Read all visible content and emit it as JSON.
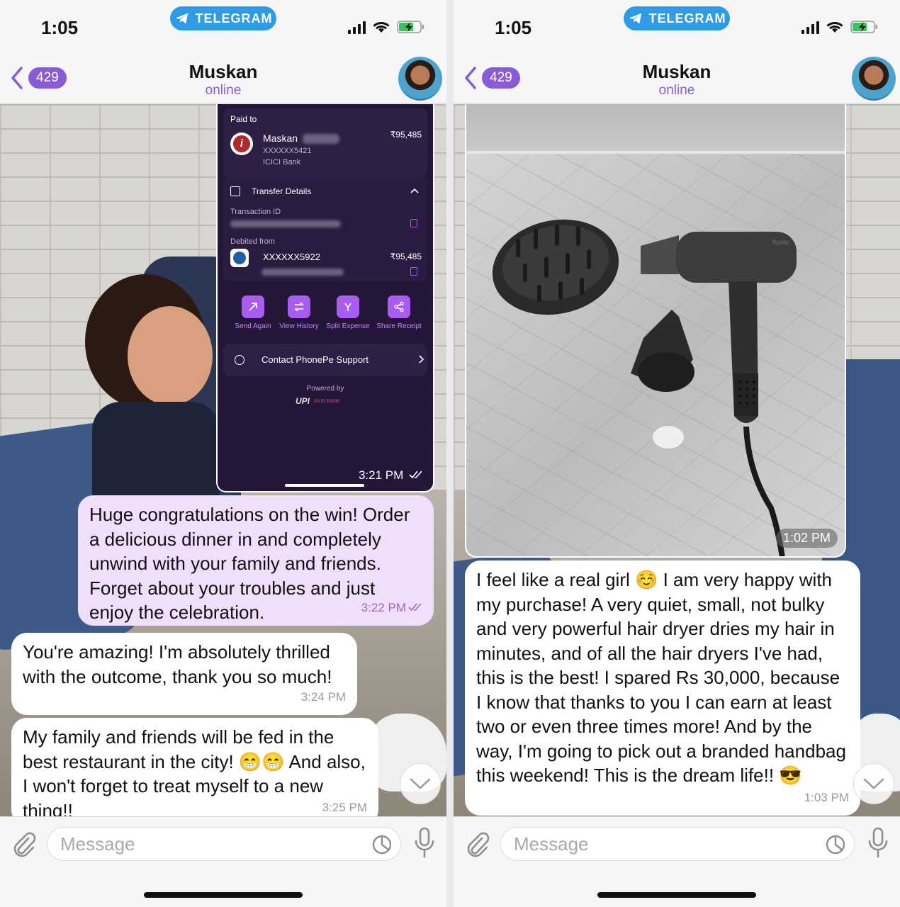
{
  "screens": [
    {
      "status": {
        "time": "1:05",
        "app_pill": "TELEGRAM"
      },
      "header": {
        "back_count": "429",
        "name": "Muskan",
        "status": "online"
      },
      "payment_card": {
        "paid_to_label": "Paid to",
        "payee_name": "Maskan",
        "payee_account": "XXXXXX5421",
        "payee_bank": "ICICI Bank",
        "amount": "₹95,485",
        "transfer_details_label": "Transfer Details",
        "transaction_id_label": "Transaction ID",
        "debited_from_label": "Debited from",
        "debit_account": "XXXXXX5922",
        "debit_amount": "₹95,485",
        "actions": [
          "Send Again",
          "View History",
          "Split Expense",
          "Share Receipt"
        ],
        "support_label": "Contact PhonePe Support",
        "powered_by": "Powered by",
        "upi_logo": "UPI",
        "bank_logo": "AXIS BANK",
        "time": "3:21 PM"
      },
      "messages": [
        {
          "type": "outgoing",
          "text": "Huge congratulations on the win! Order a delicious dinner in and completely unwind with your family and friends. Forget about your troubles and just enjoy the celebration.",
          "time": "3:22 PM"
        },
        {
          "type": "incoming",
          "text": "You're amazing! I'm absolutely thrilled with the outcome, thank you so much!",
          "time": "3:24 PM"
        },
        {
          "type": "incoming",
          "text": "My family and friends will be fed in the best restaurant in the city! 😁😁 And also, I won't forget to treat myself to a new thing!!",
          "time": "3:25 PM"
        }
      ],
      "input": {
        "placeholder": "Message"
      }
    },
    {
      "status": {
        "time": "1:05",
        "app_pill": "TELEGRAM"
      },
      "header": {
        "back_count": "429",
        "name": "Muskan",
        "status": "online"
      },
      "media": {
        "time": "1:02 PM",
        "brand_text": "Sprits"
      },
      "messages": [
        {
          "type": "incoming",
          "text": "I feel like a real girl ☺️ I am very happy with my purchase! A very quiet, small, not bulky and very powerful hair dryer dries my hair in minutes, and of all the hair dryers I've had, this is the best! I spared Rs 30,000, because I know that thanks to you I can earn at least two or even three times more! And by the way, I'm going to pick out a branded handbag this weekend! This is the dream life!! 😎",
          "time": "1:03 PM"
        }
      ],
      "input": {
        "placeholder": "Message"
      }
    }
  ],
  "colors": {
    "accent": "#8a5bd6",
    "telegram_blue": "#2e9be8",
    "outgoing_bubble": "#efdffb",
    "incoming_bubble": "#ffffff",
    "phonepe_bg": "#241638",
    "phonepe_action": "#a85cf0"
  },
  "icons": [
    "telegram-icon",
    "signal-icon",
    "wifi-icon",
    "battery-charging-icon",
    "back-chevron-icon",
    "attach-icon",
    "sticker-icon",
    "mic-icon",
    "chevron-down-icon",
    "read-check-icon"
  ]
}
